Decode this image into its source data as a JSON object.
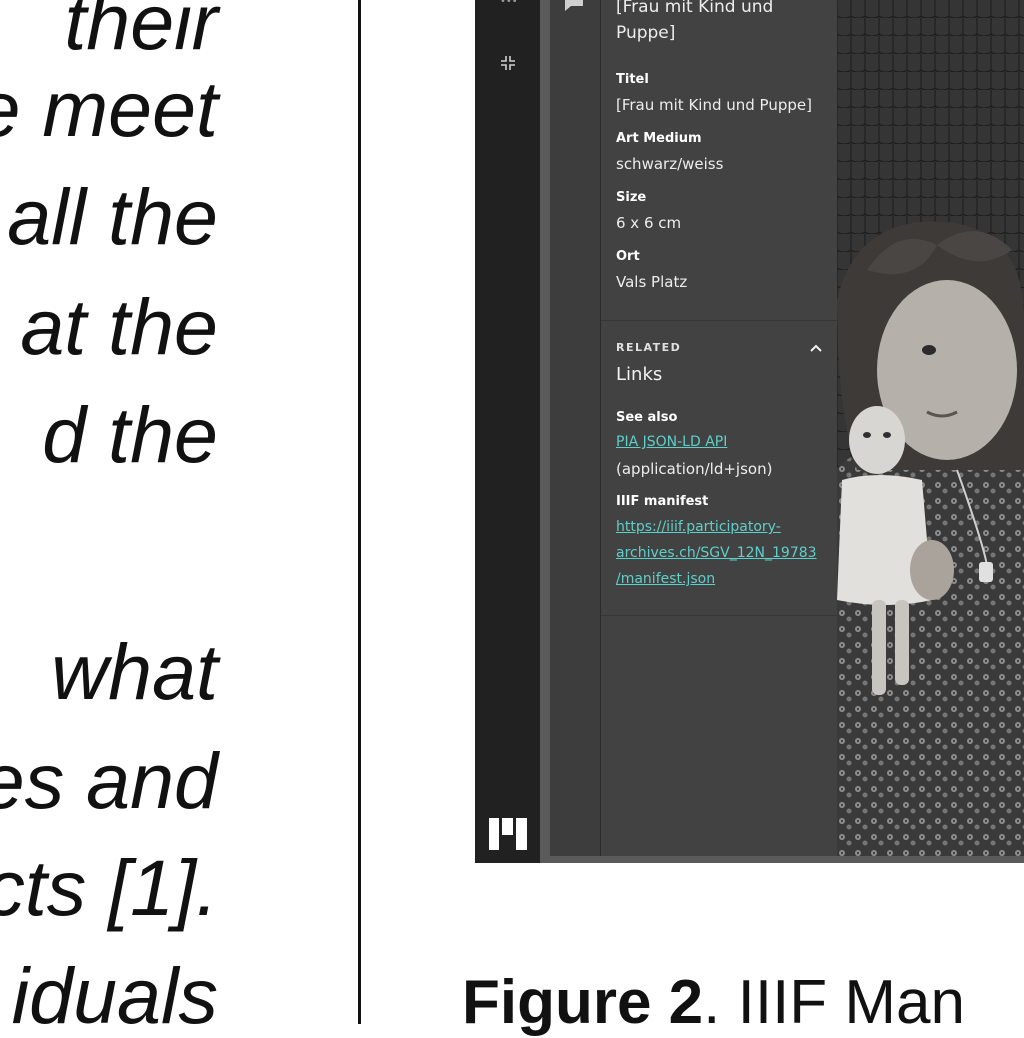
{
  "poster": {
    "lines": [
      "their",
      "e meet",
      "all the",
      "at the",
      "d the",
      "what",
      "es and",
      "cts [1].",
      "iduals"
    ]
  },
  "panel": {
    "heading": "[Frau mit Kind und Puppe]",
    "fields": [
      {
        "label": "Titel",
        "value": "[Frau mit Kind und Puppe]"
      },
      {
        "label": "Art Medium",
        "value": "schwarz/weiss"
      },
      {
        "label": "Size",
        "value": "6 x 6 cm"
      },
      {
        "label": "Ort",
        "value": "Vals Platz"
      }
    ],
    "related": {
      "section_label": "RELATED",
      "title": "Links",
      "see_also_label": "See also",
      "see_also_link": "PIA JSON-LD API",
      "see_also_type": "(application/ld+json)",
      "manifest_label": "IIIF manifest",
      "manifest_link_lines": [
        "https://iiif.participatory-",
        "archives.ch/SGV_12N_19783",
        "/manifest.json"
      ]
    }
  },
  "caption": {
    "bold": "Figure 2",
    "rest": ". IIIF Man"
  },
  "colors": {
    "link": "#5ecfc9",
    "panel_bg": "#424242",
    "rail_bg": "#212121"
  },
  "icons": [
    "collapse-icon",
    "chat-icon",
    "chevron-up-icon",
    "mirador-logo-icon"
  ]
}
